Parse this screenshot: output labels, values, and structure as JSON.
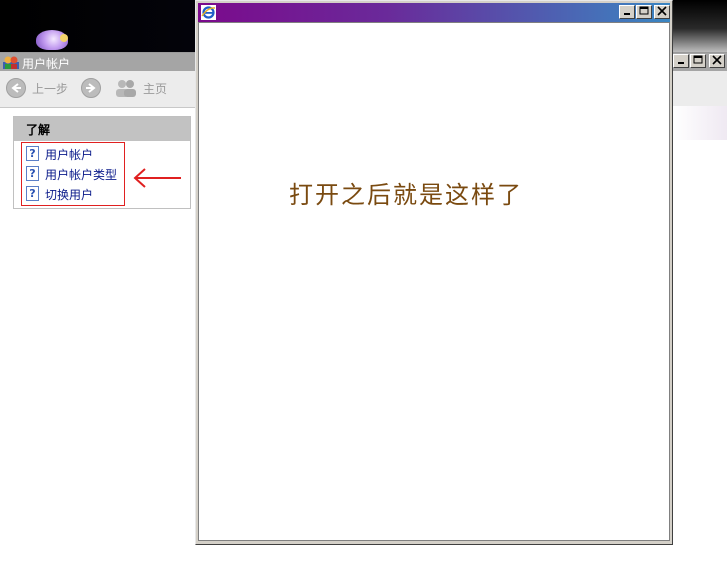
{
  "background_window": {
    "title": "用户帐户",
    "toolbar": {
      "back_label": "上一步",
      "home_label": "主页"
    },
    "panel": {
      "header": "了解",
      "items": [
        {
          "label": "用户帐户",
          "icon": "help-icon"
        },
        {
          "label": "用户帐户类型",
          "icon": "help-icon"
        },
        {
          "label": "切换用户",
          "icon": "help-icon"
        }
      ]
    },
    "caption_buttons": [
      "minimize",
      "maximize",
      "close"
    ]
  },
  "foreground_window": {
    "icon": "internet-explorer-icon",
    "title": "",
    "message": "打开之后就是这样了",
    "caption_buttons": [
      "minimize",
      "maximize",
      "close"
    ]
  },
  "annotation": {
    "arrow_color": "#e02020",
    "highlight_color": "#e02020"
  },
  "colors": {
    "fg_title_gradient_start": "#7b0a8c",
    "fg_title_gradient_end": "#3a86c2",
    "message_color": "#7a4a10",
    "link_color": "#0a1a8a"
  }
}
